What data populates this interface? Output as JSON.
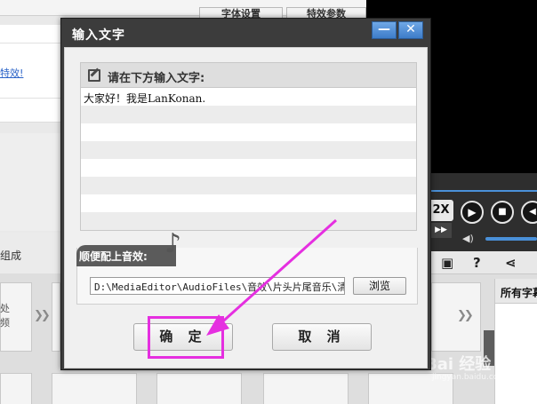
{
  "background": {
    "tabs": [
      "字体设置",
      "特效参数"
    ],
    "link_text": "特效!",
    "group_label": "组成",
    "track_cell_text": "处\n频",
    "player": {
      "speed_label": "2X",
      "ff_label": "▶▶"
    },
    "right_panel_title": "所有字幕",
    "watermark": "Bai 经验",
    "watermark_sub": "jingyan.baidu.com"
  },
  "dialog": {
    "title": "输入文字",
    "minimize_label": "—",
    "close_label": "✕",
    "text_prompt_label": "请在下方输入文字:",
    "text_value": "大家好！我是LanKonan.",
    "audio_label": "顺便配上音效:",
    "audio_path": "D:\\MediaEditor\\AudioFiles\\音效\\片头片尾音乐\\清鼠",
    "browse_label": "浏览",
    "ok_label": "确 定",
    "cancel_label": "取 消"
  },
  "colors": {
    "highlight": "#e52fe0",
    "title_bar": "#3c3c3c",
    "accent_blue": "#4a90d9"
  }
}
